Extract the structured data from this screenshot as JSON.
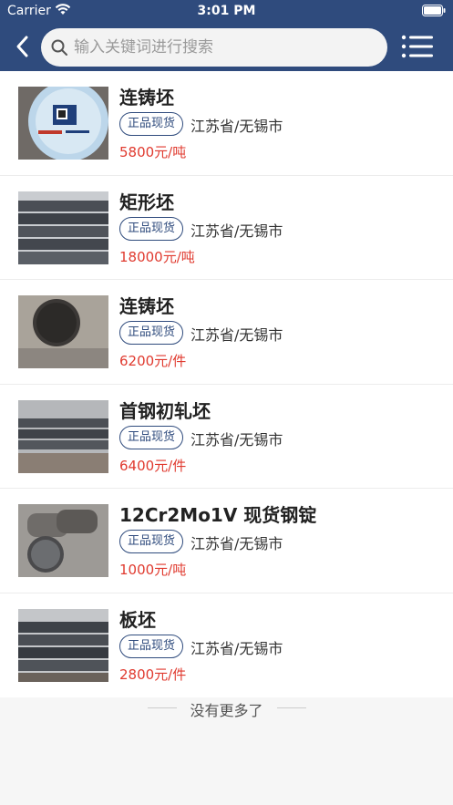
{
  "status_bar": {
    "carrier": "Carrier",
    "time": "3:01 PM"
  },
  "nav": {
    "search_placeholder": "输入关键词进行搜索"
  },
  "items": [
    {
      "title": "连铸坯",
      "badge": "正品现货",
      "location": "江苏省/无锡市",
      "price": "5800元/吨"
    },
    {
      "title": "矩形坯",
      "badge": "正品现货",
      "location": "江苏省/无锡市",
      "price": "18000元/吨"
    },
    {
      "title": "连铸坯",
      "badge": "正品现货",
      "location": "江苏省/无锡市",
      "price": "6200元/件"
    },
    {
      "title": "首钢初轧坯",
      "badge": "正品现货",
      "location": "江苏省/无锡市",
      "price": "6400元/件"
    },
    {
      "title": "12Cr2Mo1V 现货钢锭",
      "badge": "正品现货",
      "location": "江苏省/无锡市",
      "price": "1000元/吨"
    },
    {
      "title": "板坯",
      "badge": "正品现货",
      "location": "江苏省/无锡市",
      "price": "2800元/件"
    }
  ],
  "footer": {
    "text": "没有更多了"
  },
  "colors": {
    "header": "#2f4b7d",
    "price": "#e03a2f",
    "badge": "#2f4b7d"
  }
}
